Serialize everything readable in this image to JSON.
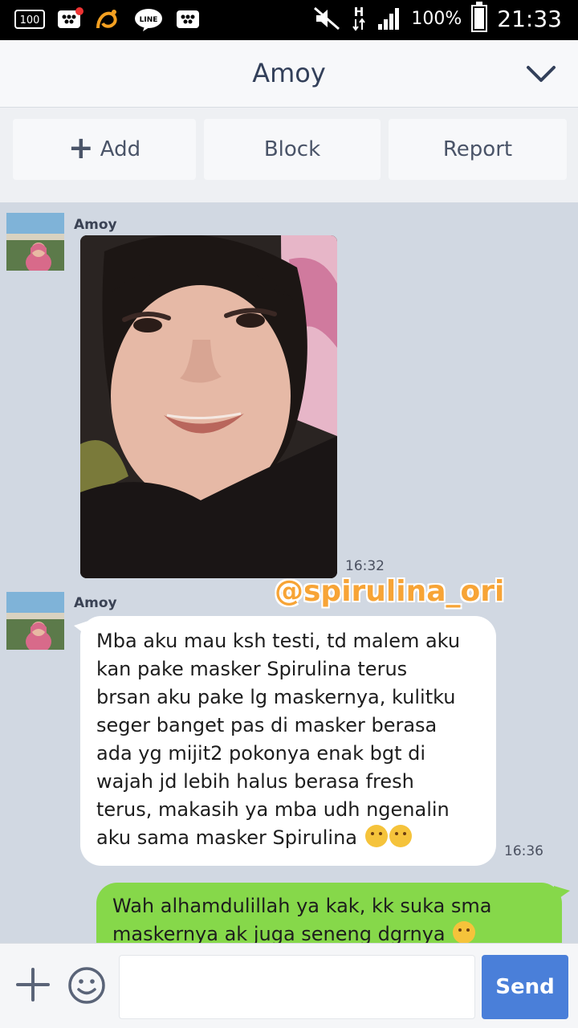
{
  "status_bar": {
    "battery_text": "100%",
    "time": "21:33",
    "notif_badge": "100",
    "net_type": "H",
    "app_label_line": "LINE"
  },
  "header": {
    "title": "Amoy"
  },
  "actions": {
    "add_label": "Add",
    "block_label": "Block",
    "report_label": "Report"
  },
  "messages": [
    {
      "sender": "Amoy",
      "type": "image",
      "time": "16:32"
    },
    {
      "sender": "Amoy",
      "type": "text",
      "time": "16:36",
      "lines": [
        "Mba aku mau ksh testi, td malem aku",
        "kan pake masker Spirulina terus",
        "brsan aku pake lg maskernya, kulitku",
        "seger banget pas di masker berasa",
        "ada yg mijit2 pokonya enak bgt di",
        "wajah jd lebih halus berasa fresh",
        "terus, makasih ya mba udh ngenalin",
        "aku sama masker Spirulina"
      ]
    },
    {
      "sender": "me",
      "type": "text",
      "lines": [
        "Wah alhamdulillah ya kak,  kk suka sma",
        "maskernya ak juga seneng dgrnya"
      ]
    }
  ],
  "watermark": "@spirulina_ori",
  "input": {
    "value": "",
    "send_label": "Send"
  },
  "colors": {
    "header_bg": "#f7f8fa",
    "chat_bg": "#d1d8e2",
    "outgoing_bubble": "#86d84a",
    "send_button": "#4a7fd9",
    "watermark": "#f7a436"
  }
}
